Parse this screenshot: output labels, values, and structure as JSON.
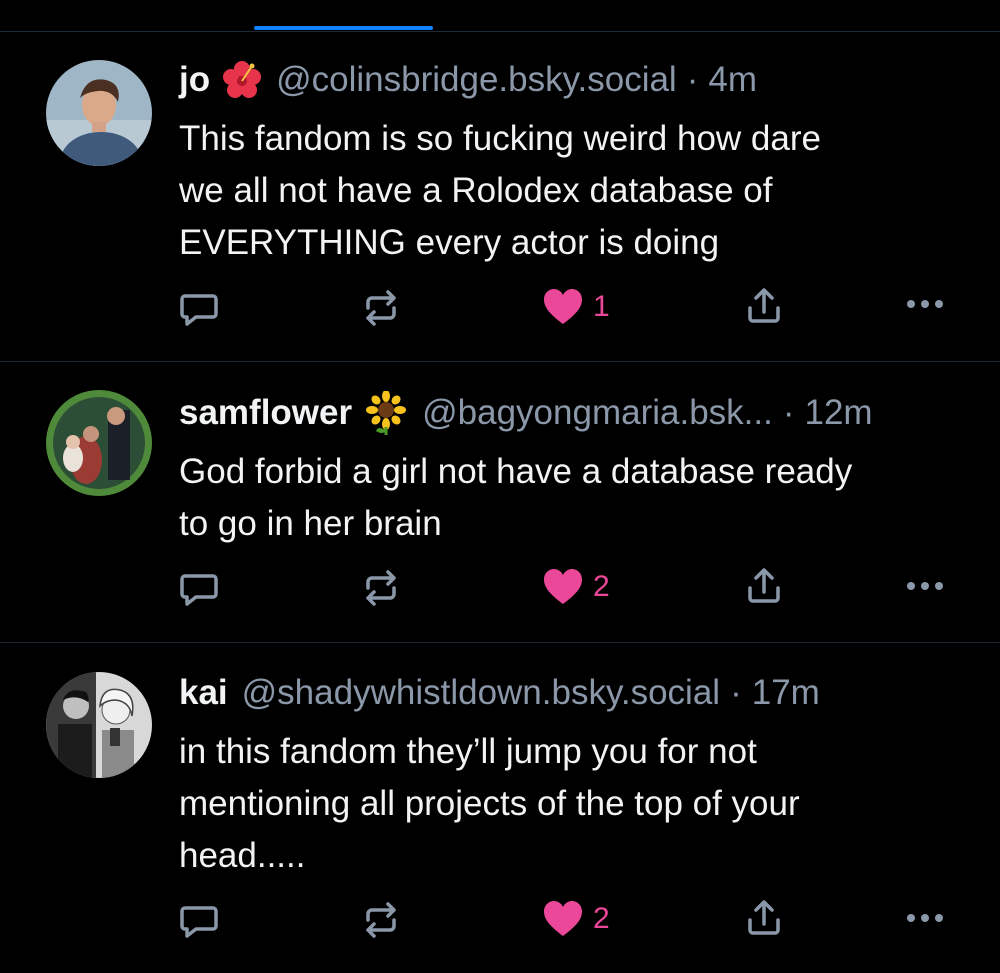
{
  "colors": {
    "background": "#000000",
    "divider": "#1e2936",
    "accent": "#1083fe",
    "like": "#ec4899",
    "muted": "#8b98a9",
    "text": "#f1f3f5"
  },
  "posts": [
    {
      "name": "jo",
      "emoji": "hibiscus-icon",
      "handle": "@colinsbridge.bsky.social",
      "separator": "·",
      "time": "4m",
      "lines": [
        "This fandom is so fucking weird how dare",
        "we all not have a Rolodex database of",
        "EVERYTHING every actor is doing"
      ],
      "likes": "1"
    },
    {
      "name": "samflower",
      "emoji": "sunflower-icon",
      "handle": "@bagyongmaria.bsk...",
      "separator": "·",
      "time": "12m",
      "lines": [
        "God forbid a girl not have a database ready",
        "to go in her brain"
      ],
      "likes": "2"
    },
    {
      "name": "kai",
      "emoji": "",
      "handle": "@shadywhistldown.bsky.social",
      "separator": "·",
      "time": "17m",
      "lines": [
        "in this fandom they’ll jump you for not",
        "mentioning all projects of the top of your",
        "head....."
      ],
      "likes": "2"
    }
  ]
}
